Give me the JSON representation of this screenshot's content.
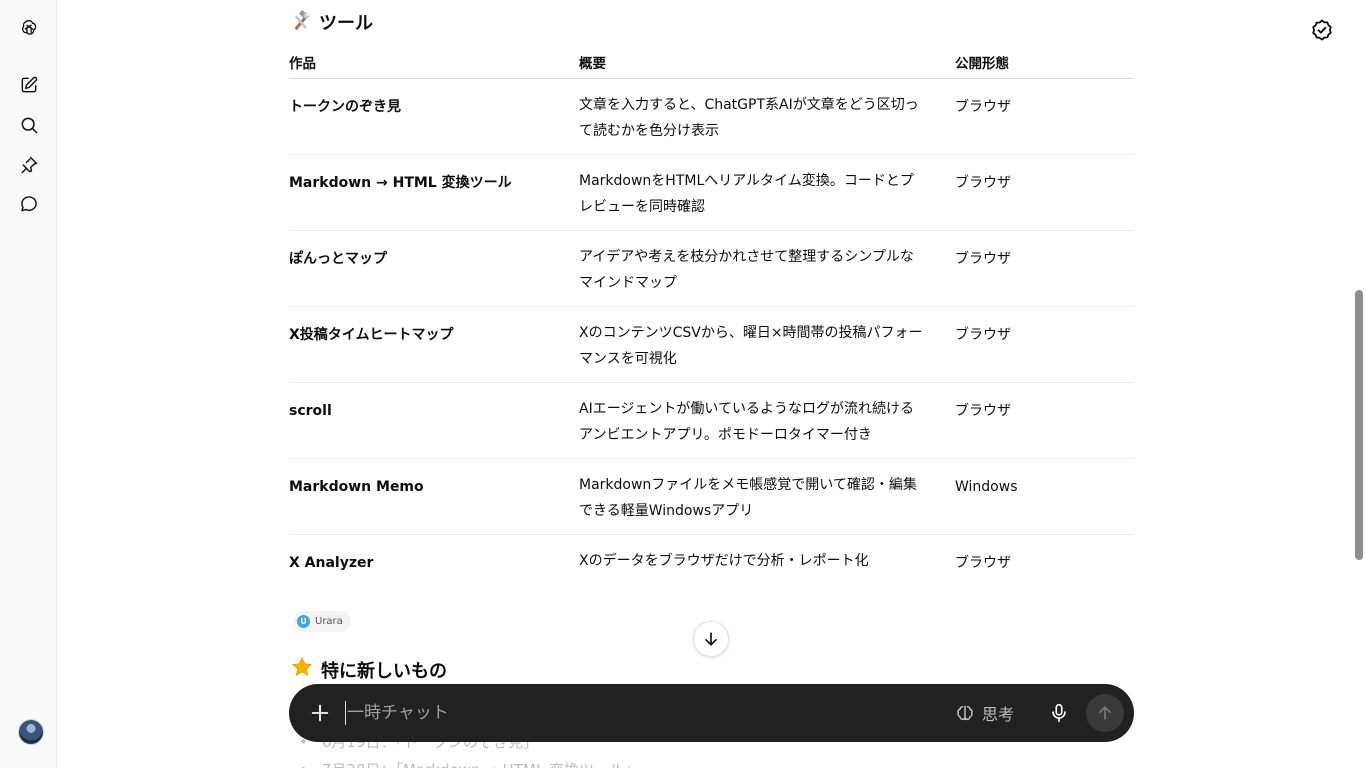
{
  "sidebar": {
    "logo_icon": "openai-logo-icon",
    "new_chat_icon": "edit-icon",
    "search_icon": "search-icon",
    "pin_icon": "pin-icon",
    "chat_icon": "chat-bubble-icon"
  },
  "header": {
    "right_icon": "check-badge-icon"
  },
  "main": {
    "section_title": "ツール",
    "table": {
      "headers": [
        "作品",
        "概要",
        "公開形態"
      ],
      "rows": [
        {
          "name": "トークンのぞき見",
          "desc": "文章を入力すると、ChatGPT系AIが文章をどう区切って読むかを色分け表示",
          "form": "ブラウザ"
        },
        {
          "name": "Markdown → HTML 変換ツール",
          "desc": "MarkdownをHTMLへリアルタイム変換。コードとプレビューを同時確認",
          "form": "ブラウザ"
        },
        {
          "name": "ぽんっとマップ",
          "desc": "アイデアや考えを枝分かれさせて整理するシンプルなマインドマップ",
          "form": "ブラウザ"
        },
        {
          "name": "X投稿タイムヒートマップ",
          "desc": "XのコンテンツCSVから、曜日×時間帯の投稿パフォーマンスを可視化",
          "form": "ブラウザ"
        },
        {
          "name": "scroll",
          "desc": "AIエージェントが働いているようなログが流れ続けるアンビエントアプリ。ポモドーロタイマー付き",
          "form": "ブラウザ"
        },
        {
          "name": "Markdown Memo",
          "desc": "Markdownファイルをメモ帳感覚で開いて確認・編集できる軽量Windowsアプリ",
          "form": "Windows"
        },
        {
          "name": "X Analyzer",
          "desc": "Xのデータをブラウザだけで分析・レポート化",
          "form": "ブラウザ"
        }
      ]
    },
    "source_chip": {
      "initial": "U",
      "label": "Urara"
    },
    "section2_title": "特に新しいもの",
    "faded_list": [
      "6月19日：「トークンのぞき見」",
      "7月28日：「Markdown → HTML 変換ツール」"
    ]
  },
  "composer": {
    "placeholder": "一時チャット",
    "think_label": "思考"
  }
}
